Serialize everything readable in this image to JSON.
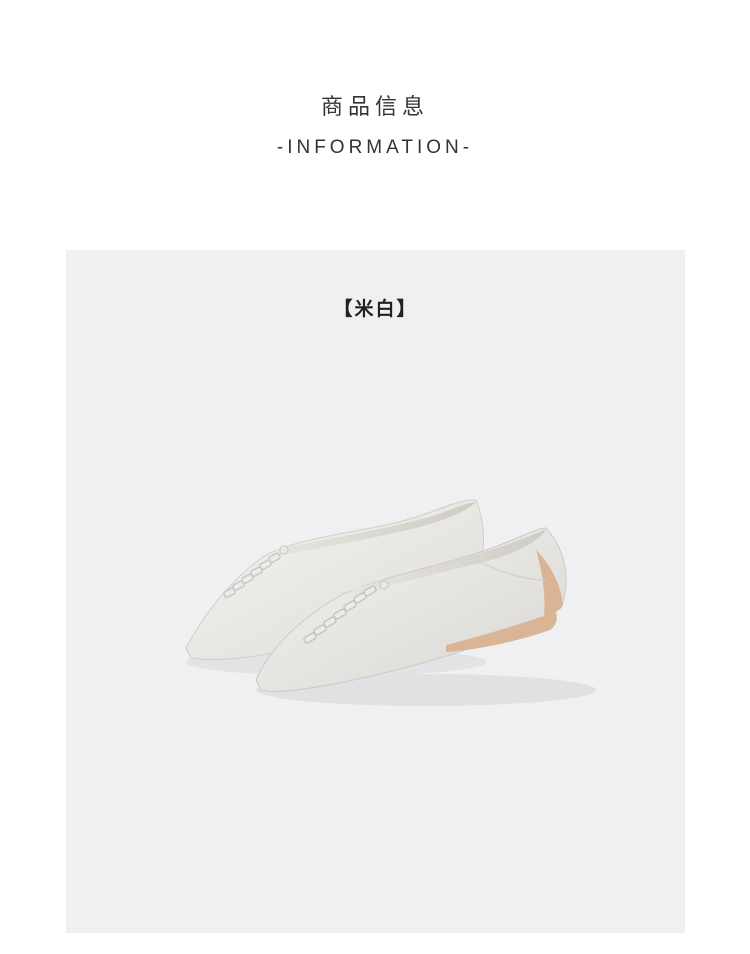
{
  "header": {
    "title_cn": "商品信息",
    "title_en": "-INFORMATION-"
  },
  "product": {
    "color_label": "【米白】",
    "image": "pair of off-white pointed-toe leather flats with woven lace detail",
    "colors": {
      "panel_background": "#f0f0f2",
      "shoe_leather": "#e8e7e3",
      "sole": "#d9b596"
    }
  }
}
